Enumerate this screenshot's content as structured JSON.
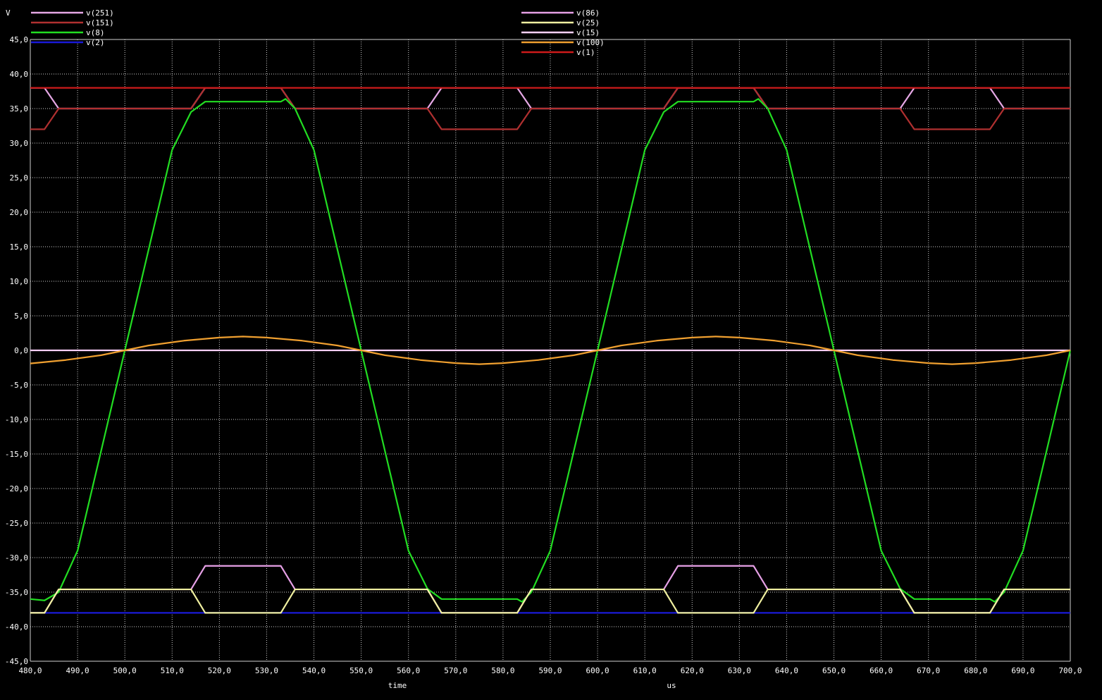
{
  "chart_data": {
    "type": "line",
    "ylabel": "V",
    "xlabel": "time",
    "xunit": "us",
    "xlim": [
      480,
      700
    ],
    "ylim": [
      -45,
      45
    ],
    "xticks": [
      "480,0",
      "490,0",
      "500,0",
      "510,0",
      "520,0",
      "530,0",
      "540,0",
      "550,0",
      "560,0",
      "570,0",
      "580,0",
      "590,0",
      "600,0",
      "610,0",
      "620,0",
      "630,0",
      "640,0",
      "650,0",
      "660,0",
      "670,0",
      "680,0",
      "690,0",
      "700,0"
    ],
    "xtick_values": [
      480,
      490,
      500,
      510,
      520,
      530,
      540,
      550,
      560,
      570,
      580,
      590,
      600,
      610,
      620,
      630,
      640,
      650,
      660,
      670,
      680,
      690,
      700
    ],
    "yticks": [
      "45,0",
      "40,0",
      "35,0",
      "30,0",
      "25,0",
      "20,0",
      "15,0",
      "10,0",
      "5,0",
      "0,0",
      "-5,0",
      "-10,0",
      "-15,0",
      "-20,0",
      "-25,0",
      "-30,0",
      "-35,0",
      "-40,0",
      "-45,0"
    ],
    "ytick_values": [
      45,
      40,
      35,
      30,
      25,
      20,
      15,
      10,
      5,
      0,
      -5,
      -10,
      -15,
      -20,
      -25,
      -30,
      -35,
      -40,
      -45
    ],
    "grid": true,
    "legend_placement": "top",
    "series": [
      {
        "name": "v(251)",
        "color": "#e6a8e6",
        "x": [
          480,
          483,
          486,
          514,
          517,
          533,
          536,
          564,
          567,
          583,
          586,
          614,
          617,
          633,
          636,
          664,
          667,
          683,
          686,
          700
        ],
        "y": [
          38,
          38,
          35,
          35,
          38,
          38,
          35,
          35,
          38,
          38,
          35,
          35,
          38,
          38,
          35,
          35,
          38,
          38,
          35,
          35
        ]
      },
      {
        "name": "v(151)",
        "color": "#b03030",
        "x": [
          480,
          483,
          486,
          514,
          517,
          533,
          536,
          564,
          567,
          583,
          586,
          614,
          617,
          633,
          636,
          664,
          667,
          683,
          686,
          700
        ],
        "y": [
          32,
          32,
          35,
          35,
          38,
          38,
          35,
          35,
          32,
          32,
          35,
          35,
          38,
          38,
          35,
          35,
          32,
          32,
          35,
          35
        ]
      },
      {
        "name": "v(8)",
        "color": "#22dd22",
        "x": [
          480,
          483,
          486,
          490,
          500,
          510,
          514,
          517,
          520,
          530,
          533,
          534,
          536,
          540,
          550,
          560,
          564,
          567,
          570,
          580,
          583,
          584,
          586,
          590,
          600,
          610,
          614,
          617,
          620,
          630,
          633,
          634,
          636,
          640,
          650,
          660,
          664,
          667,
          670,
          680,
          683,
          684,
          686,
          690,
          700
        ],
        "y": [
          -36,
          -36.2,
          -35,
          -29,
          0,
          29,
          34.5,
          36,
          36,
          36,
          36,
          36.4,
          35,
          29,
          0,
          -29,
          -34.5,
          -36,
          -36,
          -36,
          -36,
          -36.4,
          -35,
          -29,
          0,
          29,
          34.5,
          36,
          36,
          36,
          36,
          36.4,
          35,
          29,
          0,
          -29,
          -34.5,
          -36,
          -36,
          -36,
          -36,
          -36.4,
          -35,
          -29,
          0
        ]
      },
      {
        "name": "v(2)",
        "color": "#1a1ad8",
        "x": [
          480,
          700
        ],
        "y": [
          -38,
          -38
        ]
      },
      {
        "name": "v(86)",
        "color": "#e6a0e6",
        "x": [
          480,
          483,
          486,
          514,
          517,
          533,
          536,
          564,
          567,
          583,
          586,
          614,
          617,
          633,
          636,
          664,
          667,
          683,
          686,
          700
        ],
        "y": [
          -38,
          -38,
          -34.6,
          -34.6,
          -31.2,
          -31.2,
          -34.6,
          -34.6,
          -38,
          -38,
          -34.6,
          -34.6,
          -31.2,
          -31.2,
          -34.6,
          -34.6,
          -38,
          -38,
          -34.6,
          -34.6
        ]
      },
      {
        "name": "v(25)",
        "color": "#f0f0a0",
        "x": [
          480,
          483,
          486,
          514,
          517,
          533,
          536,
          564,
          567,
          583,
          586,
          614,
          617,
          633,
          636,
          664,
          667,
          683,
          686,
          700
        ],
        "y": [
          -38,
          -38,
          -34.6,
          -34.6,
          -38,
          -38,
          -34.6,
          -34.6,
          -38,
          -38,
          -34.6,
          -34.6,
          -38,
          -38,
          -34.6,
          -34.6,
          -38,
          -38,
          -34.6,
          -34.6
        ]
      },
      {
        "name": "v(15)",
        "color": "#ffd0ff",
        "x": [
          480,
          700
        ],
        "y": [
          0,
          0
        ]
      },
      {
        "name": "v(100)",
        "color": "#f0a030",
        "x": [
          480,
          487.5,
          495,
          500,
          505,
          512.5,
          520,
          525,
          530,
          537.5,
          545,
          550,
          555,
          562.5,
          570,
          575,
          580,
          587.5,
          595,
          600,
          605,
          612.5,
          620,
          625,
          630,
          637.5,
          645,
          650,
          655,
          662.5,
          670,
          675,
          680,
          687.5,
          695,
          700
        ],
        "y": [
          -1.9,
          -1.4,
          -0.7,
          0,
          0.7,
          1.4,
          1.85,
          2,
          1.85,
          1.4,
          0.7,
          0,
          -0.7,
          -1.4,
          -1.85,
          -2,
          -1.85,
          -1.4,
          -0.7,
          0,
          0.7,
          1.4,
          1.85,
          2,
          1.85,
          1.4,
          0.7,
          0,
          -0.7,
          -1.4,
          -1.85,
          -2,
          -1.85,
          -1.4,
          -0.7,
          0
        ]
      },
      {
        "name": "v(1)",
        "color": "#cc1a1a",
        "x": [
          480,
          700
        ],
        "y": [
          38,
          38
        ]
      }
    ]
  }
}
